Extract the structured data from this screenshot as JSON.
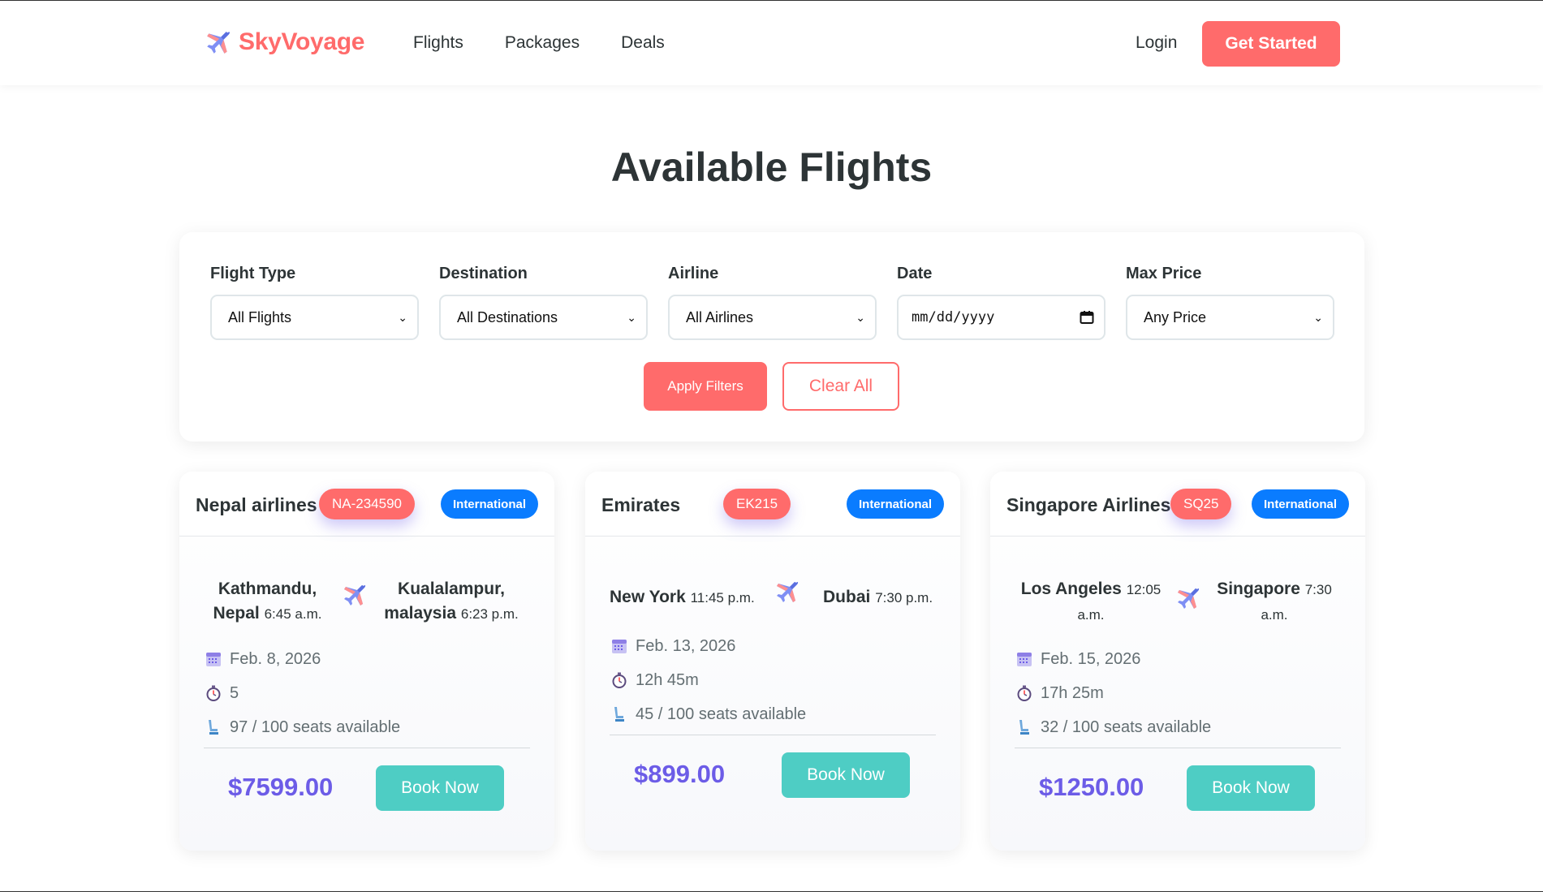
{
  "nav": {
    "brand": "SkyVoyage",
    "links": [
      "Flights",
      "Packages",
      "Deals"
    ],
    "login": "Login",
    "cta": "Get Started"
  },
  "page": {
    "title": "Available Flights"
  },
  "filters": {
    "flight_type": {
      "label": "Flight Type",
      "value": "All Flights"
    },
    "destination": {
      "label": "Destination",
      "value": "All Destinations"
    },
    "airline": {
      "label": "Airline",
      "value": "All Airlines"
    },
    "date": {
      "label": "Date",
      "value": "mm/dd/yyyy"
    },
    "max_price": {
      "label": "Max Price",
      "value": "Any Price"
    },
    "apply_label": "Apply Filters",
    "clear_label": "Clear All"
  },
  "flights": [
    {
      "airline": "Nepal airlines",
      "code": "NA-234590",
      "type": "International",
      "from_line1": "Kathmandu,",
      "from_line2": "Nepal",
      "from_time": "6:45 a.m.",
      "to_line1": "Kualalampur,",
      "to_line2": "malaysia",
      "to_time": "6:23 p.m.",
      "date": "Feb. 8, 2026",
      "duration": "5",
      "seats": "97 / 100 seats available",
      "price": "$7599.00",
      "book_label": "Book Now"
    },
    {
      "airline": "Emirates",
      "code": "EK215",
      "type": "International",
      "from": "New York",
      "from_time": "11:45 p.m.",
      "to": "Dubai",
      "to_time": "7:30 p.m.",
      "date": "Feb. 13, 2026",
      "duration": "12h 45m",
      "seats": "45 / 100 seats available",
      "price": "$899.00",
      "book_label": "Book Now"
    },
    {
      "airline": "Singapore Airlines",
      "code": "SQ25",
      "type": "International",
      "from": "Los Angeles",
      "from_time_a": "12:05",
      "from_time_b": "a.m.",
      "to": "Singapore",
      "to_time_a": "7:30",
      "to_time_b": "a.m.",
      "date": "Feb. 15, 2026",
      "duration": "17h 25m",
      "seats": "32 / 100 seats available",
      "price": "$1250.00",
      "book_label": "Book Now"
    }
  ],
  "icons": {
    "brand": "airplane-icon",
    "route": "airplane-icon",
    "date": "calendar-icon",
    "duration": "stopwatch-icon",
    "seats": "seat-icon",
    "select": "chevron-down-icon"
  },
  "colors": {
    "brand": "#ff6b6b",
    "accent_price": "#6c5ce7",
    "book": "#4ecdc4",
    "badge_type": "#0a7cff"
  }
}
